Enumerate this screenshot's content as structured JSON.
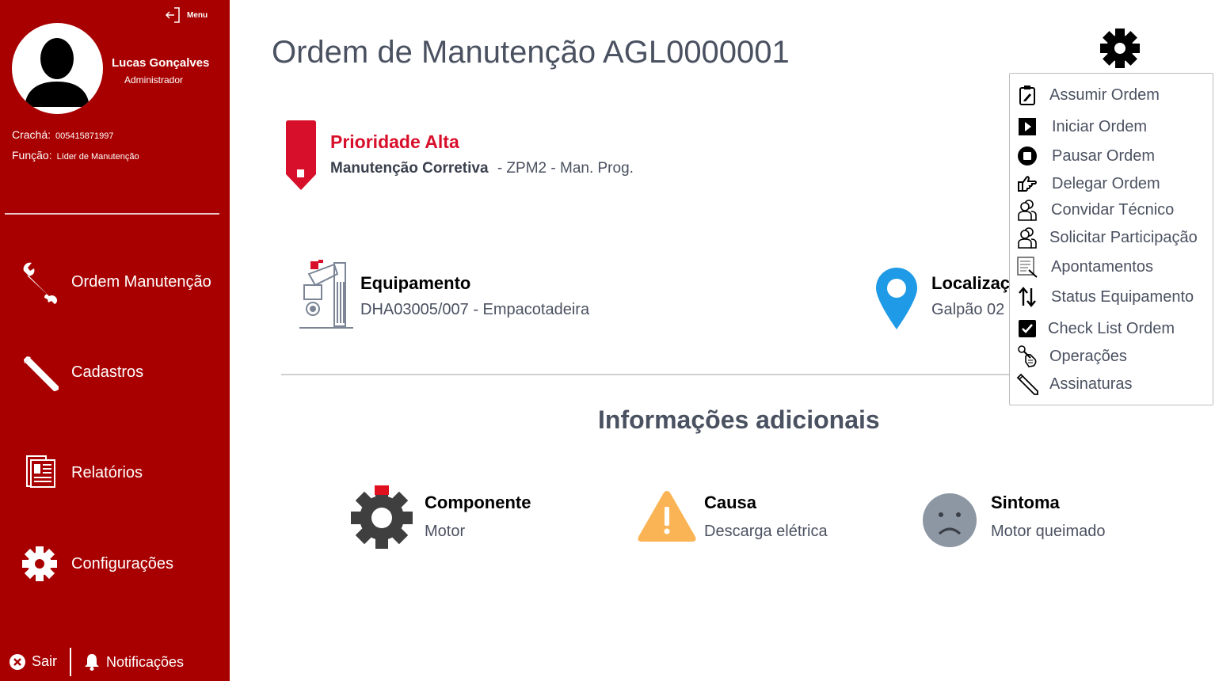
{
  "sidebar": {
    "menu_label": "Menu",
    "user": {
      "name": "Lucas Gonçalves",
      "role": "Administrador"
    },
    "badge_label": "Crachá:",
    "badge_value": "005415871997",
    "function_label": "Função:",
    "function_value": "Líder de Manutenção",
    "nav": [
      {
        "label": "Ordem Manutenção",
        "icon": "wrench-icon"
      },
      {
        "label": "Cadastros",
        "icon": "pencil-icon"
      },
      {
        "label": "Relatórios",
        "icon": "reports-icon"
      },
      {
        "label": "Configurações",
        "icon": "gear-icon"
      }
    ],
    "logout_label": "Sair",
    "notifications_label": "Notificações",
    "colors": {
      "background": "#a80000",
      "text": "#ffffff"
    }
  },
  "main": {
    "title": "Ordem de Manutenção AGL0000001",
    "priority": {
      "title": "Prioridade Alta",
      "type": "Manutenção Corretiva",
      "detail": " - ZPM2 - Man. Prog.",
      "color": "#d80f2a"
    },
    "equipment": {
      "label": "Equipamento",
      "value": "DHA03005/007 -  Empacotadeira"
    },
    "location": {
      "label": "Localizaç",
      "value": "Galpão 02"
    },
    "additional_title": "Informações adicionais",
    "additional": [
      {
        "label": "Componente",
        "value": "Motor",
        "icon": "component-gear-icon"
      },
      {
        "label": "Causa",
        "value": "Descarga elétrica",
        "icon": "warning-icon"
      },
      {
        "label": "Sintoma",
        "value": "Motor queimado",
        "icon": "sad-face-icon"
      }
    ]
  },
  "actions_menu": {
    "items": [
      {
        "label": "Assumir Ordem",
        "icon": "clipboard-edit-icon"
      },
      {
        "label": "Iniciar Ordem",
        "icon": "play-icon"
      },
      {
        "label": "Pausar Ordem",
        "icon": "stop-icon"
      },
      {
        "label": "Delegar Ordem",
        "icon": "hand-point-icon"
      },
      {
        "label": "Convidar Técnico",
        "icon": "user-invite-icon"
      },
      {
        "label": "Solicitar Participação",
        "icon": "user-request-icon"
      },
      {
        "label": "Apontamentos",
        "icon": "notes-icon"
      },
      {
        "label": "Status Equipamento",
        "icon": "arrows-updown-icon"
      },
      {
        "label": "Check List Ordem",
        "icon": "checkbox-icon"
      },
      {
        "label": "Operações",
        "icon": "operations-icon"
      },
      {
        "label": "Assinaturas",
        "icon": "pen-icon"
      }
    ]
  }
}
